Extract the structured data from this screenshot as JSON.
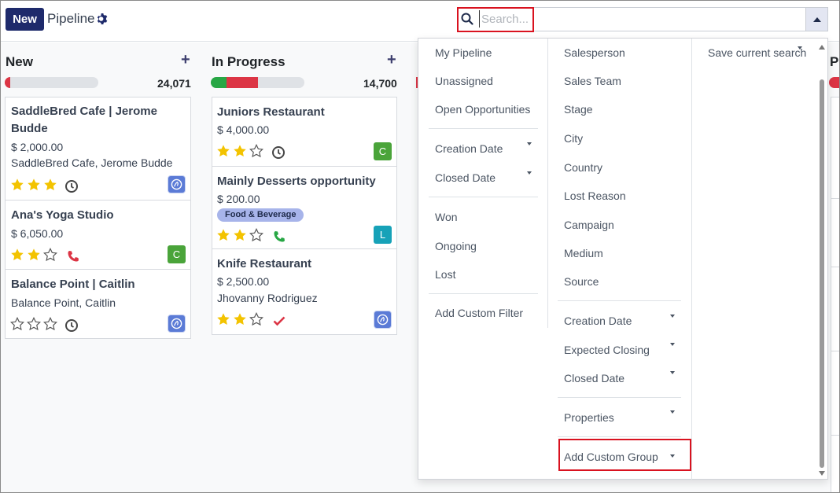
{
  "control_panel": {
    "new_label": "New",
    "title": "Pipeline",
    "search_placeholder": "Search..."
  },
  "columns": [
    {
      "title": "New",
      "total": "24,071",
      "progress": {
        "red": 0.05,
        "green": 0.0
      },
      "cards": [
        {
          "title_line1": "SaddleBred Cafe | Jerome",
          "title_line2": "Budde",
          "amount": "$ 2,000.00",
          "contact": "SaddleBred Cafe, Jerome Budde",
          "stars": 3,
          "activity": "clock-icon",
          "avatar": "logo"
        },
        {
          "title_line1": "Ana's Yoga Studio",
          "amount": "$ 6,050.00",
          "stars": 2,
          "activity": "phone-icon",
          "avatar": "C"
        },
        {
          "title_line1": "Balance Point | Caitlin",
          "contact": "Balance Point, Caitlin",
          "stars": 0,
          "activity": "clock-icon",
          "avatar": "logo"
        }
      ]
    },
    {
      "title": "In Progress",
      "total": "14,700",
      "progress": {
        "red": 0.33,
        "green": 0.17
      },
      "cards": [
        {
          "title_line1": "Juniors Restaurant",
          "amount": "$ 4,000.00",
          "stars": 2,
          "activity": "clock-icon",
          "avatar": "C"
        },
        {
          "title_line1": "Mainly Desserts opportunity",
          "amount": "$ 200.00",
          "tag": "Food & Beverage",
          "stars": 2,
          "activity": "phone-icon",
          "avatar": "L"
        },
        {
          "title_line1": "Knife Restaurant",
          "amount": "$ 2,500.00",
          "contact": "Jhovanny Rodriguez",
          "stars": 2,
          "activity": "check-icon",
          "avatar": "logo"
        }
      ]
    }
  ],
  "partial_column": {
    "title": "Pr"
  },
  "dropdown": {
    "filters": {
      "items": [
        "My Pipeline",
        "Unassigned",
        "Open Opportunities"
      ],
      "date_items": [
        "Creation Date",
        "Closed Date"
      ],
      "state_items": [
        "Won",
        "Ongoing",
        "Lost"
      ],
      "custom": "Add Custom Filter"
    },
    "group_by": {
      "items": [
        "Salesperson",
        "Sales Team",
        "Stage",
        "City",
        "Country",
        "Lost Reason",
        "Campaign",
        "Medium",
        "Source"
      ],
      "date_items": [
        "Creation Date",
        "Expected Closing",
        "Closed Date"
      ],
      "properties": "Properties",
      "custom": "Add Custom Group"
    },
    "favorites": {
      "save": "Save current search"
    }
  },
  "colors": {
    "primary": "#1e2a6b",
    "highlight": "#d9121f",
    "avatar_green": "#4aa43a",
    "avatar_teal": "#17a2b8",
    "star": "#f3c300"
  }
}
